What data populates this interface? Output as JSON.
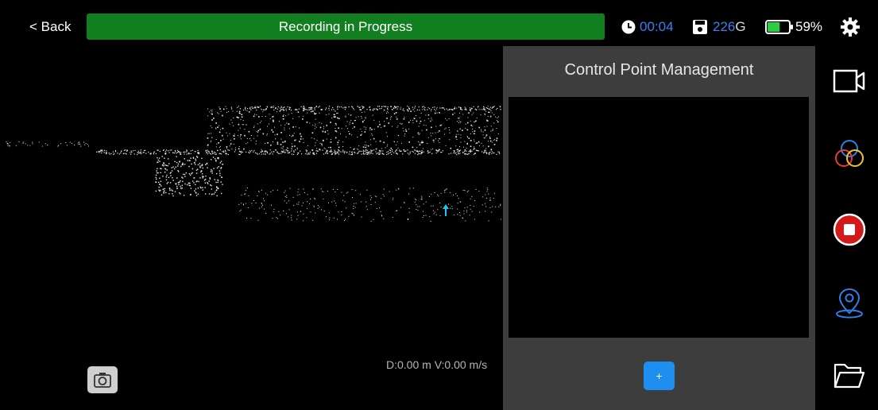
{
  "header": {
    "back_label": "< Back",
    "banner_text": "Recording in Progress",
    "elapsed_time": "00:04",
    "storage_value": "226",
    "storage_unit": "G",
    "battery_percent": "59%",
    "battery_level": 0.59
  },
  "viewport": {
    "readout": "D:0.00 m V:0.00 m/s"
  },
  "control_panel": {
    "title": "Control Point Management",
    "add_label": "+"
  },
  "colors": {
    "banner": "#117e1f",
    "accent_blue": "#3a7ff0",
    "add_button": "#1e8ff0",
    "stop_red": "#d11a1a"
  },
  "side_icons": [
    "video-camera-icon",
    "color-circles-icon",
    "stop-record-icon",
    "location-pin-icon",
    "folder-icon"
  ]
}
